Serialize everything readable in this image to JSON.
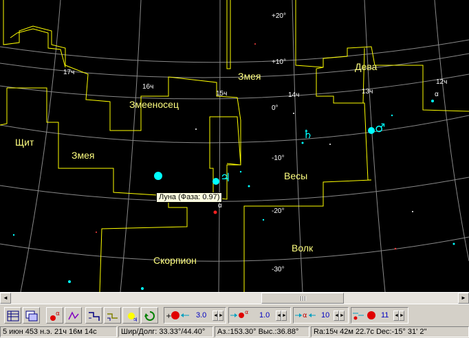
{
  "sky": {
    "constellations": {
      "virgo": "Дева",
      "serpens_caput": "Змея",
      "ophiuchus": "Змееносец",
      "scutum": "Щит",
      "serpens_cauda": "Змея",
      "libra": "Весы",
      "scorpius": "Скорпион",
      "lupus": "Волк"
    },
    "ra_labels": [
      "17ч",
      "16ч",
      "15ч",
      "14ч",
      "13ч",
      "12ч"
    ],
    "dec_labels": [
      "+20°",
      "+10°",
      "0°",
      "-10°",
      "-20°",
      "-30°"
    ],
    "star_alpha_labels": [
      "α",
      "α"
    ],
    "planet_symbols": {
      "saturn": "♄",
      "jupiter": "♃",
      "mars": "♂"
    },
    "colors": {
      "background": "#000000",
      "constellation_border": "#ffff00",
      "grid": "#8a8a8a",
      "star": "#00ffff",
      "red_star": "#ff2020"
    },
    "tooltip": "Луна (Фаза: 0.97)"
  },
  "scrollbar": {
    "left_arrow": "◄",
    "right_arrow": "►"
  },
  "toolbar": {
    "buttons": [
      {
        "id": "settings",
        "icon": "grid-settings-icon"
      },
      {
        "id": "window",
        "icon": "window-icon"
      },
      {
        "id": "stars",
        "icon": "star-alpha-icon"
      },
      {
        "id": "constellation",
        "icon": "constellation-lines-icon"
      },
      {
        "id": "borders",
        "icon": "constellation-borders-icon"
      },
      {
        "id": "grid2",
        "icon": "grid-borders-icon"
      },
      {
        "id": "planets",
        "icon": "planets-icon"
      },
      {
        "id": "rotate",
        "icon": "rotate-icon"
      }
    ],
    "spinners": [
      {
        "label": "magnitude-limit",
        "value": "3.0"
      },
      {
        "label": "star-size",
        "value": "1.0"
      },
      {
        "label": "label-limit",
        "value": "10"
      },
      {
        "label": "planet-size",
        "value": "11"
      }
    ],
    "spin_left": "◄",
    "spin_right": "►"
  },
  "status": {
    "date": "5 июн 453 н.э.  21ч 16м 14с",
    "coords": "Шир/Долг: 33.33°/44.40°",
    "altaz": "Аз.:153.30° Выс.:36.88°",
    "radec": "Ra:15ч 42м 22.7с Dec:-15° 31' 2''"
  }
}
